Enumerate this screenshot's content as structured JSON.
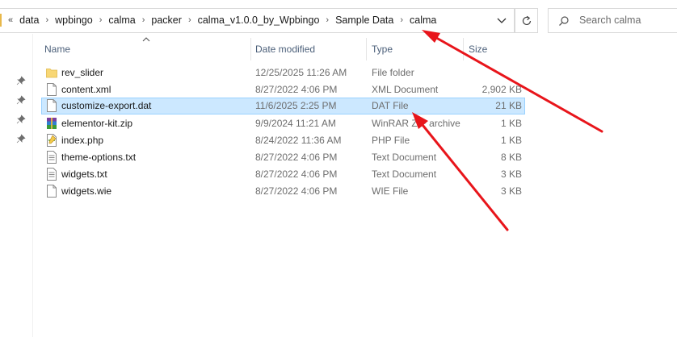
{
  "breadcrumb": {
    "overflow": "«",
    "items": [
      "data",
      "wpbingo",
      "calma",
      "packer",
      "calma_v1.0.0_by_Wpbingo",
      "Sample Data",
      "calma"
    ],
    "separator": "›"
  },
  "search": {
    "placeholder": "Search calma"
  },
  "columns": {
    "name": "Name",
    "date": "Date modified",
    "type": "Type",
    "size": "Size"
  },
  "files": [
    {
      "name": "rev_slider",
      "date": "12/25/2025 11:26 AM",
      "type": "File folder",
      "size": "",
      "icon": "folder-icon",
      "selected": false
    },
    {
      "name": "content.xml",
      "date": "8/27/2022 4:06 PM",
      "type": "XML Document",
      "size": "2,902 KB",
      "icon": "document-icon",
      "selected": false
    },
    {
      "name": "customize-export.dat",
      "date": "11/6/2025 2:25 PM",
      "type": "DAT File",
      "size": "21 KB",
      "icon": "document-icon",
      "selected": true
    },
    {
      "name": "elementor-kit.zip",
      "date": "9/9/2024 11:21 AM",
      "type": "WinRAR ZIP archive",
      "size": "1 KB",
      "icon": "winrar-archive-icon",
      "selected": false
    },
    {
      "name": "index.php",
      "date": "8/24/2022 11:36 AM",
      "type": "PHP File",
      "size": "1 KB",
      "icon": "php-file-icon",
      "selected": false
    },
    {
      "name": "theme-options.txt",
      "date": "8/27/2022 4:06 PM",
      "type": "Text Document",
      "size": "8 KB",
      "icon": "text-file-icon",
      "selected": false
    },
    {
      "name": "widgets.txt",
      "date": "8/27/2022 4:06 PM",
      "type": "Text Document",
      "size": "3 KB",
      "icon": "text-file-icon",
      "selected": false
    },
    {
      "name": "widgets.wie",
      "date": "8/27/2022 4:06 PM",
      "type": "WIE File",
      "size": "3 KB",
      "icon": "document-icon",
      "selected": false
    }
  ],
  "colors": {
    "selection": "#cce8ff",
    "selection_border": "#99d1ff",
    "arrow": "#e8151b",
    "header_text": "#4c607a"
  }
}
